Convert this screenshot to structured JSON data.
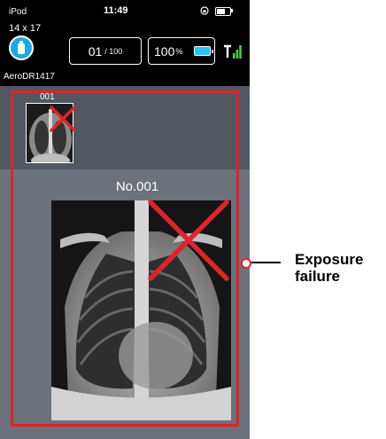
{
  "status_bar": {
    "carrier": "iPod",
    "time": "11:49"
  },
  "header": {
    "size_label": "14 x 17",
    "count_current": "01",
    "count_total": "/ 100",
    "battery_value": "100",
    "battery_unit": "%",
    "device_name": "AeroDR1417"
  },
  "thumbnails": [
    {
      "number": "001"
    }
  ],
  "main": {
    "title": "No.001"
  },
  "callout": {
    "line1": "Exposure",
    "line2": "failure"
  },
  "colors": {
    "accent_red": "#e0232b",
    "device_blue": "#1aa9e6",
    "battery_cyan": "#24c7f0",
    "signal_green": "#3fd14b"
  },
  "icons": [
    "lock-rotation-icon",
    "status-battery-icon",
    "detector-device-icon",
    "detector-battery-icon",
    "signal-strength-icon",
    "failure-x-icon"
  ]
}
